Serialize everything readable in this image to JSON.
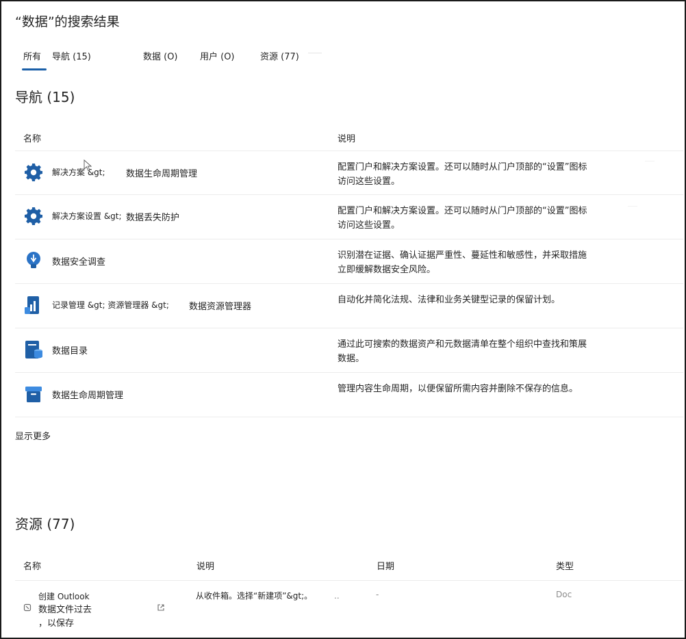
{
  "page": {
    "title": "“数据”的搜索结果"
  },
  "tabs": [
    {
      "label": "所有"
    },
    {
      "label": "导航 (15)"
    },
    {
      "label": "数据 (O)"
    },
    {
      "label": "用户 (O)"
    },
    {
      "label": "资源 (77)"
    }
  ],
  "navigation": {
    "title": "导航 (15)",
    "columns": {
      "name": "名称",
      "description": "说明"
    },
    "rows": [
      {
        "icon": "gear-icon",
        "crumb": "解决方案 &gt;",
        "target": "数据生命周期管理",
        "description": "配置门户和解决方案设置。还可以随时从门户顶部的“设置”图标访问这些设置。"
      },
      {
        "icon": "gear-icon",
        "crumb": "解决方案设置 &gt;",
        "target": "数据丢失防护",
        "description": "配置门户和解决方案设置。还可以随时从门户顶部的“设置”图标访问这些设置。"
      },
      {
        "icon": "lightbulb-icon",
        "crumb": "",
        "target": "数据安全调查",
        "description": "识别潜在证据、确认证据严重性、蔓延性和敏感性，并采取措施立即缓解数据安全风险。"
      },
      {
        "icon": "records-chart-icon",
        "crumb": "记录管理 &gt; 资源管理器 &gt;",
        "target": "数据资源管理器",
        "description": "自动化并简化法规、法律和业务关键型记录的保留计划。"
      },
      {
        "icon": "data-catalog-icon",
        "crumb": "",
        "target": "数据目录",
        "description": "通过此可搜索的数据资产和元数据清单在整个组织中查找和策展数据。"
      },
      {
        "icon": "archive-box-icon",
        "crumb": "",
        "target": "数据生命周期管理",
        "description": "管理内容生命周期，以便保留所需内容并删除不保存的信息。"
      }
    ],
    "show_more": "显示更多"
  },
  "resources": {
    "title": "资源 (77)",
    "columns": {
      "name": "名称",
      "description": "说明",
      "date": "日期",
      "type": "类型"
    },
    "rows": [
      {
        "name_line1": "创建 Outlook",
        "name_line2": "数据文件过去",
        "name_line3": "，以保存",
        "description": "从收件箱。选择“新建项”&gt;。",
        "description_more": "..",
        "date": "-",
        "type": "Doc"
      }
    ]
  },
  "colors": {
    "accent": "#1a5fa8",
    "icon_blue": "#1f5fa6",
    "icon_light": "#3d8be0"
  }
}
